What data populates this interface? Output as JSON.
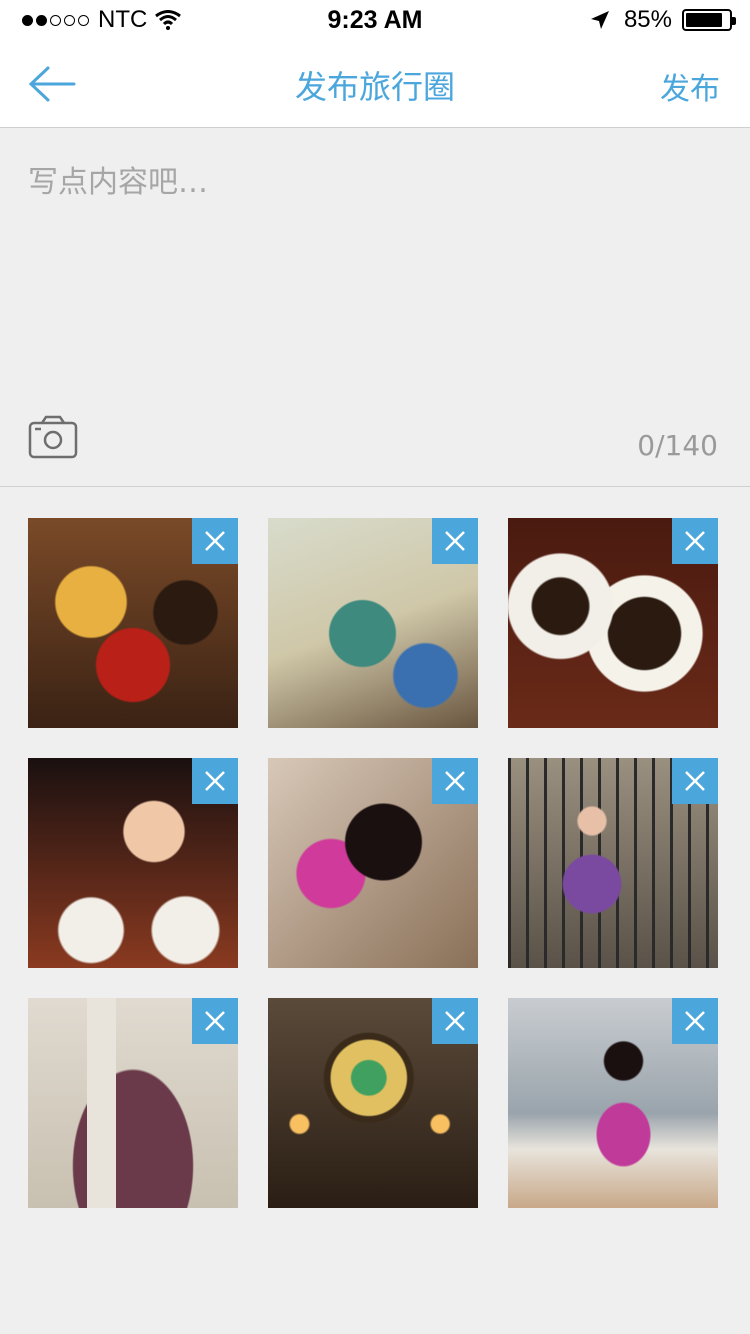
{
  "status_bar": {
    "carrier": "NTC",
    "time": "9:23 AM",
    "battery_percent": "85%",
    "battery_level": 0.85,
    "signal_bars": 2,
    "signal_total": 5
  },
  "nav": {
    "back_icon": "arrow-left-icon",
    "title": "发布旅行圈",
    "publish_label": "发布"
  },
  "compose": {
    "placeholder": "写点内容吧…",
    "value": "",
    "char_count": "0/140",
    "camera_icon": "camera-icon"
  },
  "photos": [
    {
      "subject": "lucky cats figurines",
      "remove_icon": "close-icon"
    },
    {
      "subject": "hand-drawn map postcards",
      "remove_icon": "close-icon"
    },
    {
      "subject": "latte art cups",
      "remove_icon": "close-icon"
    },
    {
      "subject": "girl with latte cups",
      "remove_icon": "close-icon"
    },
    {
      "subject": "girl writing",
      "remove_icon": "close-icon"
    },
    {
      "subject": "girl at church fence",
      "remove_icon": "close-icon"
    },
    {
      "subject": "church doors",
      "remove_icon": "close-icon"
    },
    {
      "subject": "stained glass window with cross",
      "remove_icon": "close-icon"
    },
    {
      "subject": "girl on beach",
      "remove_icon": "close-icon"
    }
  ],
  "colors": {
    "accent": "#4ba6dc",
    "background": "#efefef",
    "bar_background": "#ffffff"
  }
}
